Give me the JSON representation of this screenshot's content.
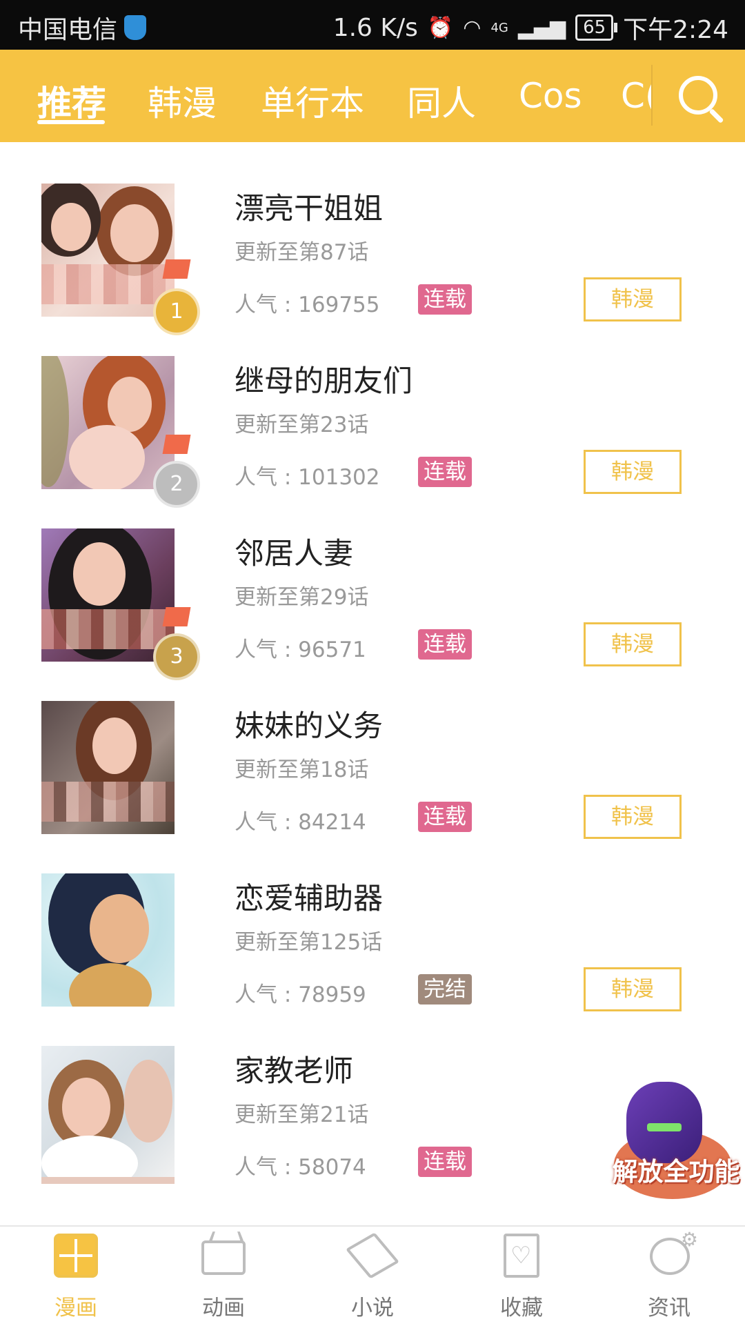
{
  "status_bar": {
    "carrier": "中国电信",
    "speed": "1.6 K/s",
    "network": "4G",
    "battery": "65",
    "time": "下午2:24"
  },
  "top_tabs": [
    {
      "label": "推荐",
      "active": true
    },
    {
      "label": "韩漫",
      "active": false
    },
    {
      "label": "单行本",
      "active": false
    },
    {
      "label": "同人",
      "active": false
    },
    {
      "label": "Cos",
      "active": false
    },
    {
      "label": "C(",
      "active": false
    }
  ],
  "comics": [
    {
      "title": "漂亮干姐姐",
      "update": "更新至第87话",
      "popularity": "人气 : 169755",
      "status": "连载",
      "genre": "韩漫",
      "rank": "1"
    },
    {
      "title": "继母的朋友们",
      "update": "更新至第23话",
      "popularity": "人气 : 101302",
      "status": "连载",
      "genre": "韩漫",
      "rank": "2"
    },
    {
      "title": "邻居人妻",
      "update": "更新至第29话",
      "popularity": "人气 : 96571",
      "status": "连载",
      "genre": "韩漫",
      "rank": "3"
    },
    {
      "title": "妹妹的义务",
      "update": "更新至第18话",
      "popularity": "人气 : 84214",
      "status": "连载",
      "genre": "韩漫",
      "rank": ""
    },
    {
      "title": "恋爱辅助器",
      "update": "更新至第125话",
      "popularity": "人气 : 78959",
      "status": "完结",
      "genre": "韩漫",
      "rank": ""
    },
    {
      "title": "家教老师",
      "update": "更新至第21话",
      "popularity": "人气 : 58074",
      "status": "连载",
      "genre": "",
      "rank": ""
    }
  ],
  "colors": {
    "accent": "#f6c343",
    "status_ongoing": "#e0688f",
    "status_finished": "#a08a7c",
    "badge_gold": "#e8b43a",
    "badge_silver": "#bdbdbd",
    "badge_bronze": "#c8a24c"
  },
  "promo": {
    "label": "解放全功能"
  },
  "bottom_nav": [
    {
      "label": "漫画",
      "icon": "comic-grid-icon",
      "active": true
    },
    {
      "label": "动画",
      "icon": "tv-icon",
      "active": false
    },
    {
      "label": "小说",
      "icon": "book-icon",
      "active": false
    },
    {
      "label": "收藏",
      "icon": "favorite-icon",
      "active": false
    },
    {
      "label": "资讯",
      "icon": "news-icon",
      "active": false
    }
  ]
}
